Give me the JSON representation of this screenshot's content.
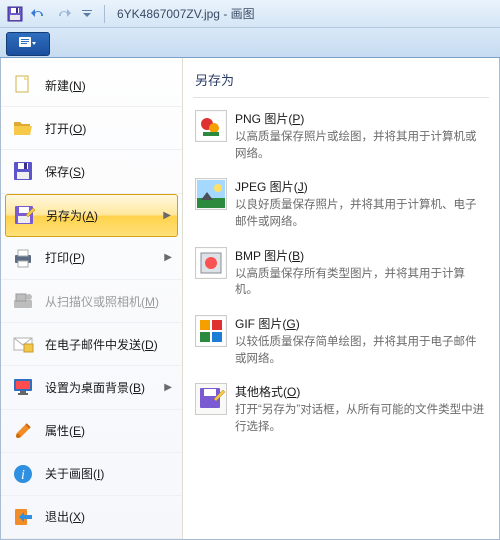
{
  "titlebar": {
    "filename": "6YK4867007ZV.jpg",
    "appname": "画图"
  },
  "left_menu": [
    {
      "label": "新建",
      "key": "N",
      "icon": "new",
      "disabled": false,
      "arrow": false
    },
    {
      "label": "打开",
      "key": "O",
      "icon": "open",
      "disabled": false,
      "arrow": false
    },
    {
      "label": "保存",
      "key": "S",
      "icon": "save",
      "disabled": false,
      "arrow": false
    },
    {
      "label": "另存为",
      "key": "A",
      "icon": "saveas",
      "disabled": false,
      "arrow": true,
      "selected": true
    },
    {
      "label": "打印",
      "key": "P",
      "icon": "print",
      "disabled": false,
      "arrow": true
    },
    {
      "label": "从扫描仪或照相机",
      "key": "M",
      "icon": "scanner",
      "disabled": true,
      "arrow": false
    },
    {
      "label": "在电子邮件中发送",
      "key": "D",
      "icon": "mail",
      "disabled": false,
      "arrow": false
    },
    {
      "label": "设置为桌面背景",
      "key": "B",
      "icon": "desktop",
      "disabled": false,
      "arrow": true
    },
    {
      "label": "属性",
      "key": "E",
      "icon": "props",
      "disabled": false,
      "arrow": false
    },
    {
      "label": "关于画图",
      "key": "I",
      "icon": "about",
      "disabled": false,
      "arrow": false
    },
    {
      "label": "退出",
      "key": "X",
      "icon": "exit",
      "disabled": false,
      "arrow": false
    }
  ],
  "right_panel": {
    "title": "另存为",
    "items": [
      {
        "title_pre": "PNG 图片",
        "key": "P",
        "desc": "以高质量保存照片或绘图，并将其用于计算机或网络。",
        "icon": "png"
      },
      {
        "title_pre": "JPEG 图片",
        "key": "J",
        "desc": "以良好质量保存照片，并将其用于计算机、电子邮件或网络。",
        "icon": "jpeg"
      },
      {
        "title_pre": "BMP 图片",
        "key": "B",
        "desc": "以高质量保存所有类型图片，并将其用于计算机。",
        "icon": "bmp"
      },
      {
        "title_pre": "GIF 图片",
        "key": "G",
        "desc": "以较低质量保存简单绘图，并将其用于电子邮件或网络。",
        "icon": "gif"
      },
      {
        "title_pre": "其他格式",
        "key": "O",
        "desc": "打开“另存为”对话框，从所有可能的文件类型中进行选择。",
        "icon": "other"
      }
    ]
  }
}
